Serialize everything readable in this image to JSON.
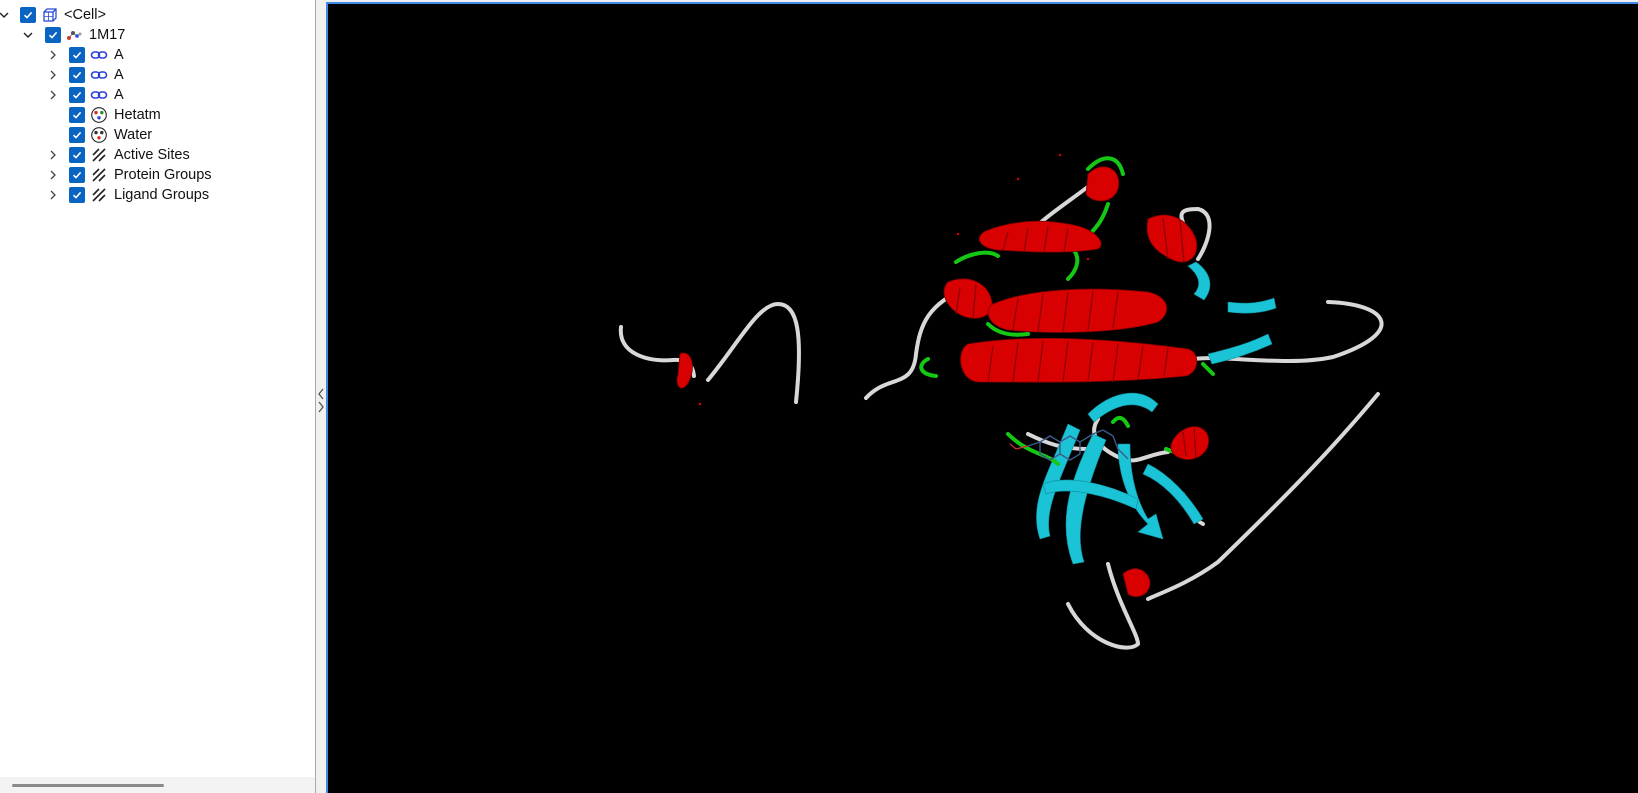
{
  "tree": {
    "rows": [
      {
        "label": "<Cell>",
        "icon": "cube-icon",
        "expanded": true,
        "checked": true
      },
      {
        "label": "1M17",
        "icon": "molecule-icon",
        "expanded": true,
        "checked": true
      },
      {
        "label": "A",
        "icon": "chain-link-icon",
        "expanded": false,
        "checked": true
      },
      {
        "label": "A",
        "icon": "chain-link-icon",
        "expanded": false,
        "checked": true
      },
      {
        "label": "A",
        "icon": "chain-link-icon",
        "expanded": false,
        "checked": true
      },
      {
        "label": "Hetatm",
        "icon": "atom-group-icon",
        "checked": true
      },
      {
        "label": "Water",
        "icon": "water-group-icon",
        "checked": true
      },
      {
        "label": "Active Sites",
        "icon": "hatch-group-icon",
        "expanded": false,
        "checked": true
      },
      {
        "label": "Protein Groups",
        "icon": "hatch-group-icon",
        "expanded": false,
        "checked": true
      },
      {
        "label": "Ligand Groups",
        "icon": "hatch-group-icon",
        "expanded": false,
        "checked": true
      }
    ]
  },
  "viewport": {
    "background": "#000000",
    "structure": "protein ribbon cartoon",
    "colors": {
      "helix": "#d80000",
      "sheet": "#1bc3d6",
      "turn": "#14c814",
      "coil": "#d8d8d8",
      "ligand": "#3c5a8a"
    }
  },
  "colors": {
    "checkbox": "#0a64c2",
    "focus_border": "#3f8ae6"
  }
}
